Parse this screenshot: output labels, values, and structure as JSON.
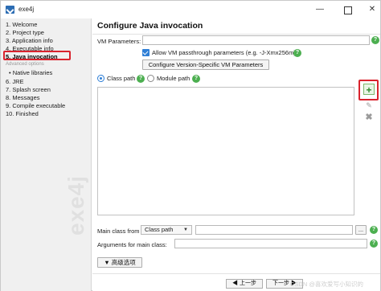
{
  "window": {
    "title": "exe4j",
    "minimize": "—",
    "close": "✕"
  },
  "sidebar": {
    "items": [
      {
        "label": "1. Welcome"
      },
      {
        "label": "2. Project type"
      },
      {
        "label": "3. Application info"
      },
      {
        "label": "4. Executable info"
      },
      {
        "label": "5. Java invocation"
      },
      {
        "label": "Advanced options"
      },
      {
        "label": "• Native libraries"
      },
      {
        "label": "6. JRE"
      },
      {
        "label": "7. Splash screen"
      },
      {
        "label": "8. Messages"
      },
      {
        "label": "9. Compile executable"
      },
      {
        "label": "10. Finished"
      }
    ],
    "watermark": "exe4j"
  },
  "main": {
    "title": "Configure Java invocation",
    "vm_parameters_label": "VM Parameters:",
    "vm_parameters_value": "",
    "allow_passthrough_label": "Allow VM passthrough parameters (e.g. -J-Xmx256m)",
    "allow_passthrough_checked": true,
    "configure_vm_button": "Configure Version-Specific VM Parameters",
    "classpath_radio": "Class path",
    "modulepath_radio": "Module path",
    "add_icon": "+",
    "edit_icon": "✎",
    "remove_icon": "✖",
    "main_class_from_label": "Main class from",
    "main_class_from_value": "Class path",
    "main_class_value": "",
    "browse_button": "...",
    "arguments_label": "Arguments for main class:",
    "arguments_value": "",
    "advanced_button": "▼ 高级选项",
    "help_glyph": "?"
  },
  "footer": {
    "prev_button": "◀ 上一步",
    "next_button": "下一步 ▶",
    "watermark": "CSDN @喜欢爱写小知识的"
  },
  "colors": {
    "accent": "#2f7fd6",
    "help": "#4caf50",
    "highlight": "#d9232d"
  }
}
